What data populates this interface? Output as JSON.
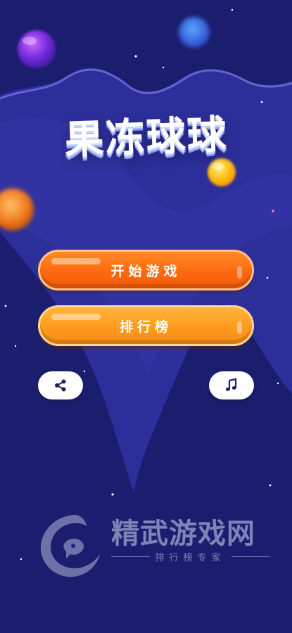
{
  "game": {
    "title": "果冻球球",
    "start_button": "开始游戏",
    "rank_button": "排行榜"
  },
  "icons": {
    "share": "share-icon",
    "music": "music-note-icon"
  },
  "watermark": {
    "name": "精武游戏网",
    "tagline": "排行榜专家"
  },
  "colors": {
    "background": "#20237b",
    "start_button": "#ff6a10",
    "rank_button": "#ff9b1f",
    "pill": "#ffffff"
  }
}
